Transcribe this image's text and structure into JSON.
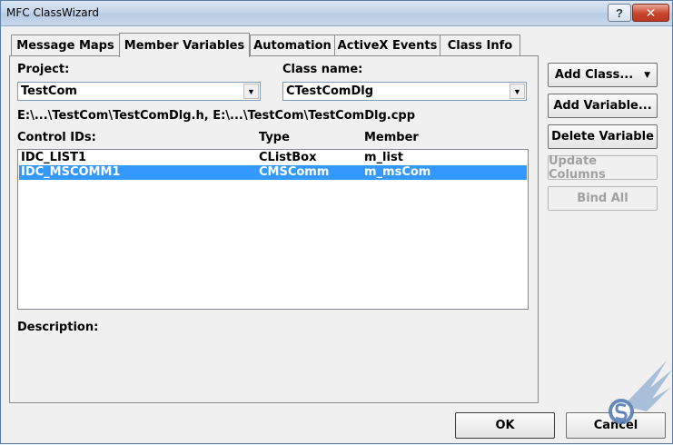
{
  "window": {
    "title": "MFC ClassWizard",
    "help_glyph": "?",
    "close_glyph": "✕"
  },
  "tabs": [
    {
      "label": "Message Maps"
    },
    {
      "label": "Member Variables"
    },
    {
      "label": "Automation"
    },
    {
      "label": "ActiveX Events"
    },
    {
      "label": "Class Info"
    }
  ],
  "form": {
    "project_label": "Project:",
    "project_value": "TestCom",
    "classname_label": "Class name:",
    "classname_value": "CTestComDlg",
    "path_text": "E:\\...\\TestCom\\TestComDlg.h, E:\\...\\TestCom\\TestComDlg.cpp",
    "col_control": "Control IDs:",
    "col_type": "Type",
    "col_member": "Member",
    "description_label": "Description:"
  },
  "rows": [
    {
      "id": "IDC_LIST1",
      "type": "CListBox",
      "member": "m_list",
      "selected": false
    },
    {
      "id": "IDC_MSCOMM1",
      "type": "CMSComm",
      "member": "m_msCom",
      "selected": true
    }
  ],
  "buttons": {
    "add_class": "Add Class...",
    "add_variable": "Add Variable...",
    "delete_variable": "Delete Variable",
    "update_columns": "Update Columns",
    "bind_all": "Bind All",
    "ok": "OK",
    "cancel": "Cancel"
  },
  "colors": {
    "selection": "#3399ff",
    "close_button": "#c8432b"
  }
}
